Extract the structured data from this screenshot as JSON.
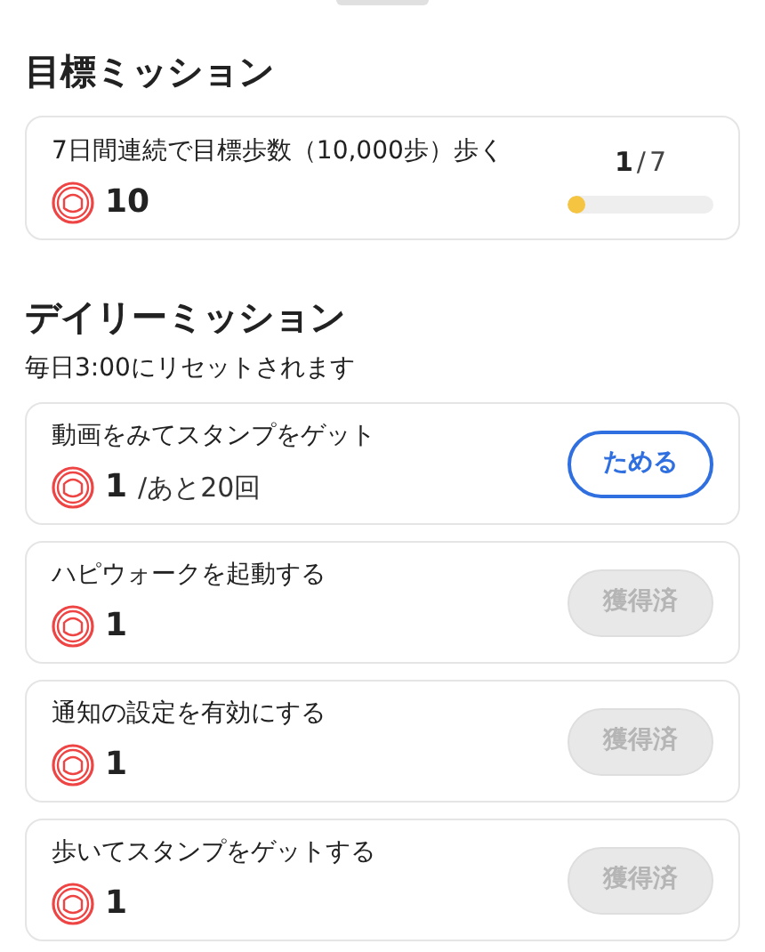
{
  "goal_section": {
    "title": "目標ミッション",
    "missions": [
      {
        "title": "7日間連続で目標歩数（10,000歩）歩く",
        "reward": "10",
        "progress_current": "1",
        "progress_separator": "/",
        "progress_total": "7",
        "level": 0.04
      }
    ]
  },
  "daily_section": {
    "title": "デイリーミッション",
    "subtitle": "毎日3:00にリセットされます",
    "missions": [
      {
        "title": "動画をみてスタンプをゲット",
        "reward": "1",
        "remaining": "/あと20回",
        "button": {
          "label": "ためる",
          "disabled": false
        }
      },
      {
        "title": "ハピウォークを起動する",
        "reward": "1",
        "button": {
          "label": "獲得済",
          "disabled": true
        }
      },
      {
        "title": "通知の設定を有効にする",
        "reward": "1",
        "button": {
          "label": "獲得済",
          "disabled": true
        }
      },
      {
        "title": "歩いてスタンプをゲットする",
        "reward": "1",
        "button": {
          "label": "獲得済",
          "disabled": true
        }
      }
    ]
  }
}
